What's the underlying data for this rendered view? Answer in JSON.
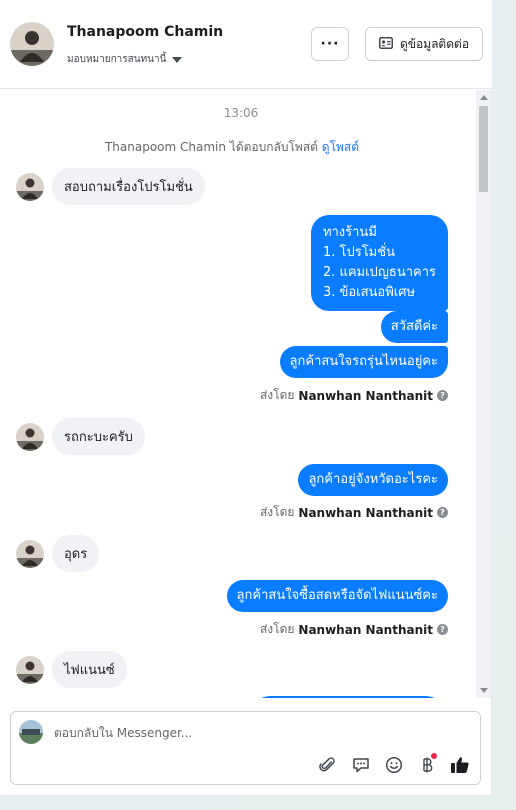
{
  "header": {
    "name": "Thanapoom Chamin",
    "assign_label": "มอบหมายการสนทนานี้",
    "more_label": "···",
    "contact_label": "ดูข้อมูลติดต่อ"
  },
  "chat": {
    "timestamp": "13:06",
    "notice_prefix": "Thanapoom Chamin ได้ตอบกลับโพสต์",
    "notice_link": "ดูโพสต์",
    "messages_in": [
      "สอบถามเรื่องโปรโมชั่น",
      "รถกะบะครับ",
      "อุดร",
      "ไฟแนนซ์"
    ],
    "messages_out": [
      [
        "ทางร้านมี",
        "1. โปรโมชั่น",
        "2. แคมเปญธนาคาร",
        "3. ข้อเสนอพิเศษ"
      ],
      "สวัสดีค่ะ",
      "ลูกค้าสนใจรถรุ่นไหนอยู่คะ",
      "ลูกค้าอยู่จังหวัดอะไรคะ",
      "ลูกค้าสนใจซื้อสดหรือจัดไฟแนนซ์คะ"
    ],
    "sent_by_prefix": "ส่งโดย",
    "sent_by_name": "Nanwhan Nanthanit",
    "help_mark": "?"
  },
  "composer": {
    "placeholder": "ตอบกลับใน Messenger..."
  },
  "colors": {
    "outgoing_bubble": "#0a7cff",
    "incoming_bubble": "#f0f2f5",
    "accent": "#1877f2"
  },
  "icons": [
    "more-icon",
    "contact-card-icon",
    "attach-icon",
    "saved-reply-icon",
    "emoji-icon",
    "payment-icon",
    "like-icon"
  ]
}
